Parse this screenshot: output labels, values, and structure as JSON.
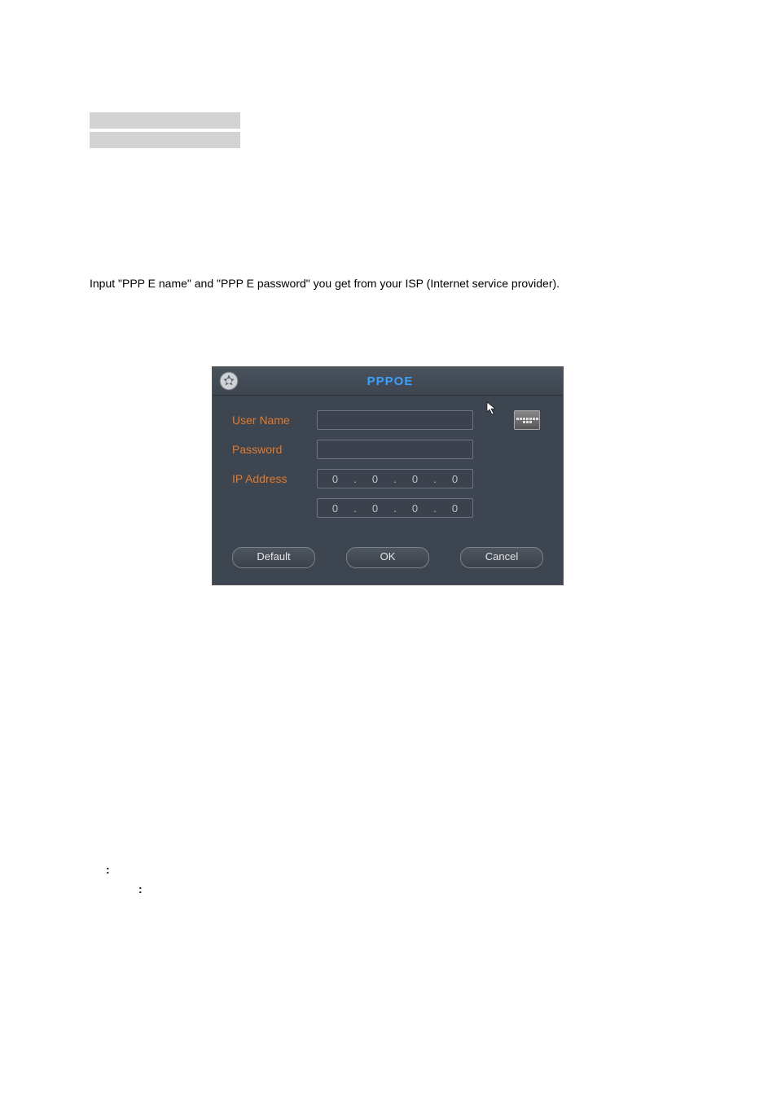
{
  "bars": {
    "present": true
  },
  "paragraph1": "Input \"PPP E name\" and \"PPP E password\" you get from your ISP (Internet service provider).",
  "dialog": {
    "title": "PPPOE",
    "labels": {
      "username": "User Name",
      "password": "Password",
      "ipaddress": "IP Address"
    },
    "ip1": {
      "a": "0",
      "b": "0",
      "c": "0",
      "d": "0"
    },
    "ip2": {
      "a": "0",
      "b": "0",
      "c": "0",
      "d": "0"
    },
    "buttons": {
      "default": "Default",
      "ok": "OK",
      "cancel": "Cancel"
    }
  },
  "colon1": ":",
  "colon2": ":"
}
